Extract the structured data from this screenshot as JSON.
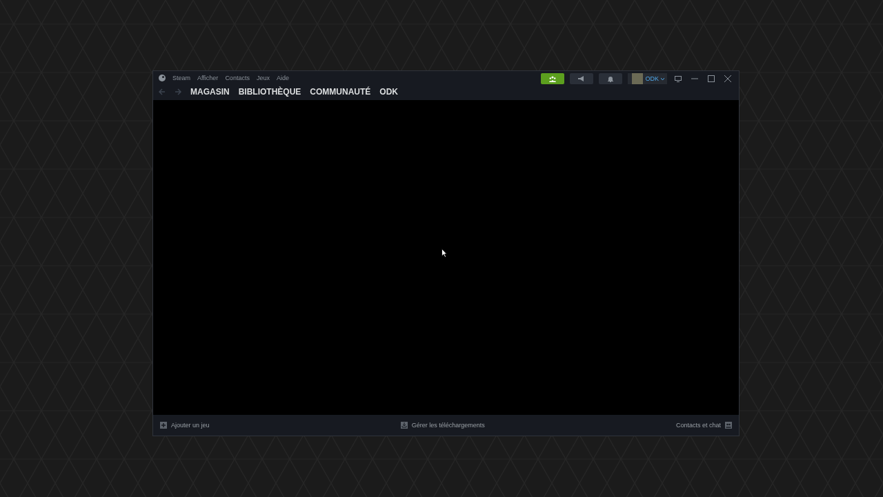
{
  "window": {
    "menu": [
      "Steam",
      "Afficher",
      "Contacts",
      "Jeux",
      "Aide"
    ],
    "nav_tabs": [
      "MAGASIN",
      "BIBLIOTHÈQUE",
      "COMMUNAUTÉ",
      "ODK"
    ],
    "account": {
      "name": "ODK"
    },
    "footer": {
      "add_game": "Ajouter un jeu",
      "downloads": "Gérer les téléchargements",
      "friends": "Contacts et chat"
    }
  }
}
